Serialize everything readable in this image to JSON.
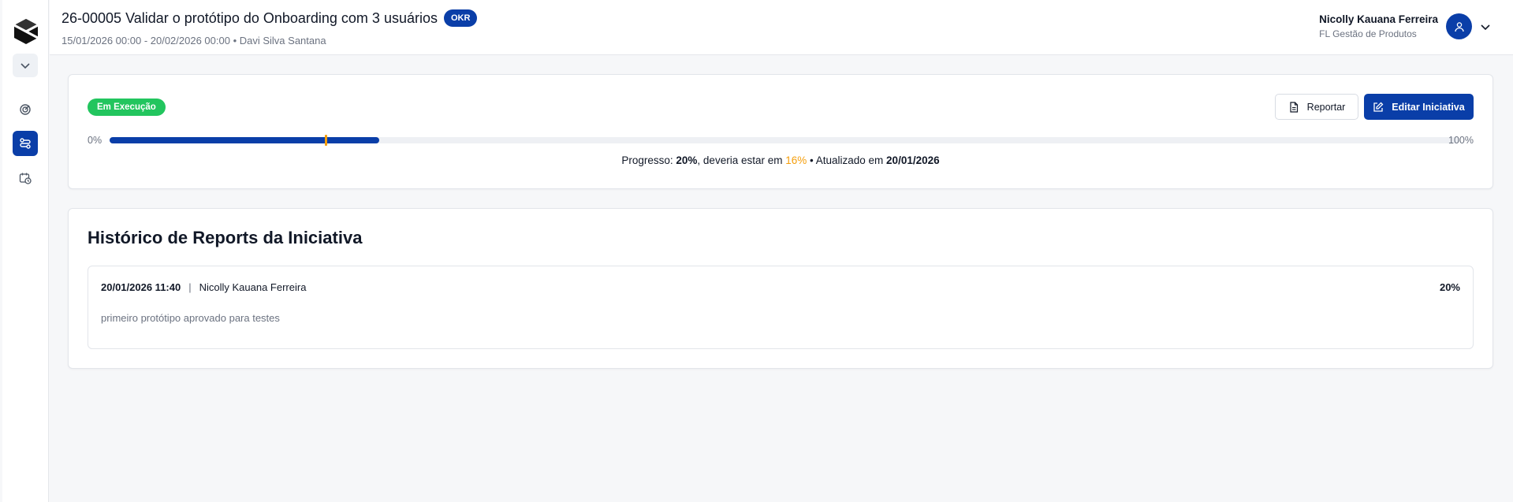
{
  "header": {
    "title": "26-00005 Validar o protótipo do Onboarding com 3 usuários",
    "badge": "OKR",
    "subtitle": "15/01/2026 00:00 - 20/02/2026 00:00 • Davi Silva Santana",
    "user": {
      "name": "Nicolly Kauana Ferreira",
      "role": "FL Gestão de Produtos"
    }
  },
  "sidebar": {
    "icons": [
      "logo-icon",
      "chevron-down-icon",
      "target-icon",
      "initiatives-icon",
      "calendar-clock-icon"
    ],
    "active_index": 1
  },
  "progress_card": {
    "status": "Em Execução",
    "report_label": "Reportar",
    "edit_label": "Editar Iniciativa",
    "min_label": "0%",
    "max_label": "100%",
    "progress_value": 20,
    "expected_value": 16,
    "text_prefix": "Progresso: ",
    "progress_text": "20%",
    "text_middle": ", deveria estar em ",
    "expected_text": "16%",
    "text_updated": " • Atualizado em ",
    "updated_date": "20/01/2026"
  },
  "history": {
    "title": "Histórico de Reports da Iniciativa",
    "reports": [
      {
        "datetime": "20/01/2026 11:40",
        "separator": "|",
        "author": "Nicolly Kauana Ferreira",
        "percent": "20%",
        "comment": "primeiro protótipo aprovado para testes"
      }
    ]
  },
  "colors": {
    "primary": "#0a3ea8",
    "status_green": "#22c55e",
    "expected_orange": "#f59e0b"
  }
}
